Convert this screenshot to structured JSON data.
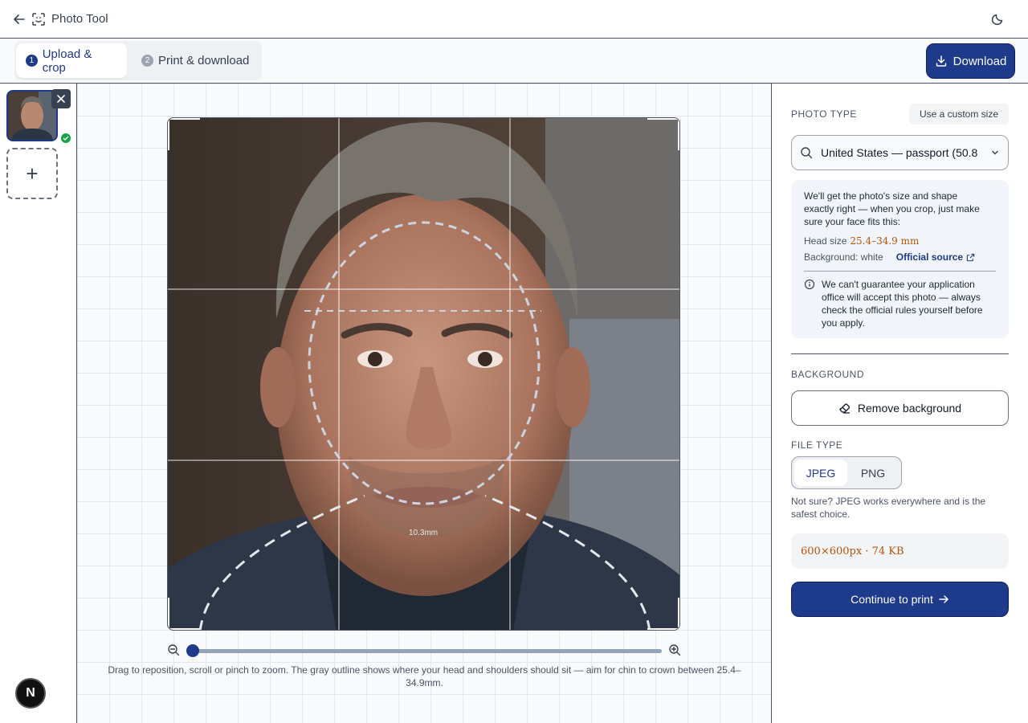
{
  "header": {
    "title": "Photo Tool",
    "back_icon": "arrow-left-icon",
    "logo_icon": "scan-face-icon",
    "theme_icon": "moon-icon"
  },
  "toolbar": {
    "steps": [
      {
        "number": "1",
        "label": "Upload & crop",
        "active": true
      },
      {
        "number": "2",
        "label": "Print & download",
        "active": false
      }
    ],
    "download_label": "Download"
  },
  "rail": {
    "add_label": "+",
    "badge_label": "N"
  },
  "canvas": {
    "measure_label": "10.3mm",
    "zoom_level": 0.0,
    "help_text": "Drag to reposition, scroll or pinch to zoom. The gray outline shows where your head and shoulders should sit — aim for chin to crown between 25.4–34.9mm."
  },
  "panel": {
    "photo_type_label": "PHOTO TYPE",
    "custom_size_label": "Use a custom size",
    "selected_type": "United States — passport (50.8",
    "info": {
      "intro": "We'll get the photo's size and shape exactly right — when you crop, just make sure your face fits this:",
      "head_size_label": "Head size",
      "head_size_value": "25.4–34.9 mm",
      "background_label": "Background: white",
      "official_source_label": "Official source",
      "warning": "We can't guarantee your application office will accept this photo — always check the official rules yourself before you apply."
    },
    "background_label": "BACKGROUND",
    "remove_bg_label": "Remove background",
    "file_type_label": "FILE TYPE",
    "file_types": [
      "JPEG",
      "PNG"
    ],
    "selected_file_type": "JPEG",
    "file_type_help": "Not sure? JPEG works everywhere and is the safest choice.",
    "output_size": "600×600px · 74 KB",
    "continue_label": "Continue to print"
  },
  "colors": {
    "accent": "#1e3a8a",
    "success": "#16a34a",
    "mono_value": "#b45309"
  }
}
